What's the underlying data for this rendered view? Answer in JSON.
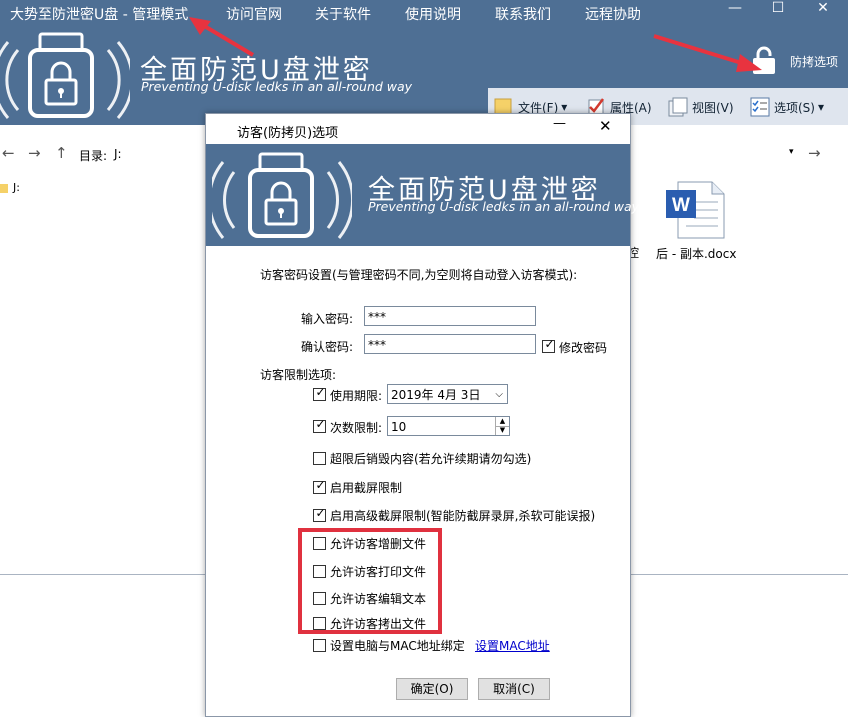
{
  "main": {
    "title": "大势至防泄密U盘 - 管理模式",
    "menu": [
      "访问官网",
      "关于软件",
      "使用说明",
      "联系我们",
      "远程协助"
    ],
    "window_controls": [
      "—",
      "☐",
      "✕"
    ],
    "banner_title": "全面防范U盘泄密",
    "banner_subtitle": "Preventing U-disk ledks in an all-round way",
    "protect_options_label": "防拷选项",
    "toolbar": {
      "file": "文件(F)",
      "properties": "属性(A)",
      "view": "视图(V)",
      "options": "选项(S)"
    },
    "address_label": "目录:",
    "address_value": "J:",
    "tree_item": "J:",
    "files": [
      {
        "name": "后 - 副本.docx",
        "icon": "word-doc-icon"
      }
    ],
    "partial_file_label": "控"
  },
  "dialog": {
    "title": "访客(防拷贝)选项",
    "close_glyph": "✕",
    "minimize_glyph": "—",
    "banner_title": "全面防范U盘泄密",
    "banner_subtitle": "Preventing U-disk ledks in an all-round way",
    "password_section": "访客密码设置(与管理密码不同,为空则将自动登入访客模式):",
    "password_label": "输入密码:",
    "password_value": "***",
    "confirm_label": "确认密码:",
    "confirm_value": "***",
    "modify_password": {
      "label": "修改密码",
      "checked": true
    },
    "restrict_section": "访客限制选项:",
    "expiry": {
      "label": "使用期限:",
      "checked": true,
      "value": "2019年  4月  3日"
    },
    "count": {
      "label": "次数限制:",
      "checked": true,
      "value": "10"
    },
    "options": [
      {
        "label": "超限后销毁内容(若允许续期请勿勾选)",
        "checked": false
      },
      {
        "label": "启用截屏限制",
        "checked": true
      },
      {
        "label": "启用高级截屏限制(智能防截屏录屏,杀软可能误报)",
        "checked": true
      },
      {
        "label": "允许访客增删文件",
        "checked": false
      },
      {
        "label": "允许访客打印文件",
        "checked": false
      },
      {
        "label": "允许访客编辑文本",
        "checked": false
      },
      {
        "label": "允许访客拷出文件",
        "checked": false
      },
      {
        "label": "设置电脑与MAC地址绑定",
        "checked": false
      }
    ],
    "mac_link": "设置MAC地址",
    "ok_button": "确定(O)",
    "cancel_button": "取消(C)"
  },
  "colors": {
    "header_blue": "#4e6f94",
    "highlight_red": "#e0313f",
    "arrow_red": "#e8333f",
    "link_blue": "#0000cc"
  }
}
